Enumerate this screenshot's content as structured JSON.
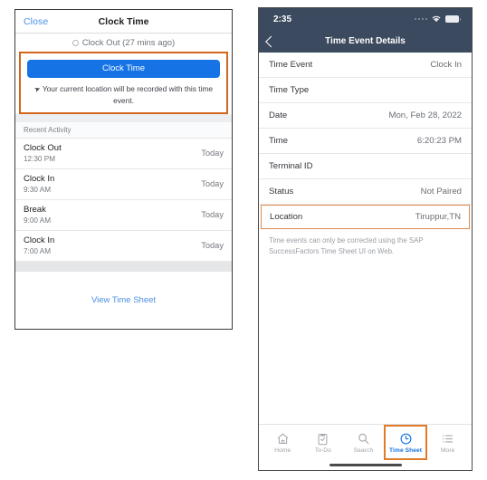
{
  "left_panel": {
    "header": {
      "close_label": "Close",
      "title": "Clock Time"
    },
    "status_option": {
      "label": "Clock Out (27 mins ago)",
      "radio_state": "unselected"
    },
    "primary_button": {
      "label": "Clock Time",
      "color": "#1673e6"
    },
    "location_note": "Your current location will be recorded with this time event.",
    "highlight_color": "#d4661e",
    "recent_activity": {
      "section_title": "Recent Activity",
      "rows": [
        {
          "title": "Clock Out",
          "time": "12:30 PM",
          "day": "Today"
        },
        {
          "title": "Clock In",
          "time": "9:30 AM",
          "day": "Today"
        },
        {
          "title": "Break",
          "time": "9:00 AM",
          "day": "Today"
        },
        {
          "title": "Clock In",
          "time": "7:00 AM",
          "day": "Today"
        }
      ]
    },
    "footer_link": "View Time Sheet"
  },
  "right_panel": {
    "status_bar": {
      "time": "2:35",
      "wifi_icon": "wifi-icon",
      "battery_icon": "battery-icon",
      "signal_icon": "signal-dots-icon"
    },
    "nav": {
      "back_icon": "chevron-left-icon",
      "title": "Time Event Details"
    },
    "details": [
      {
        "label": "Time Event",
        "value": "Clock In",
        "highlighted": false
      },
      {
        "label": "Time Type",
        "value": "",
        "highlighted": false
      },
      {
        "label": "Date",
        "value": "Mon, Feb 28, 2022",
        "highlighted": false
      },
      {
        "label": "Time",
        "value": "6:20:23 PM",
        "highlighted": false
      },
      {
        "label": "Terminal ID",
        "value": "",
        "highlighted": false
      },
      {
        "label": "Status",
        "value": "Not Paired",
        "highlighted": false
      },
      {
        "label": "Location",
        "value": "Tiruppur,TN",
        "highlighted": true
      }
    ],
    "highlight_color": "#e08a4d",
    "footer_note": "Time events can only be corrected using the SAP SuccessFactors Time Sheet UI on Web.",
    "tabs": [
      {
        "label": "Home",
        "icon": "home-icon",
        "active": false
      },
      {
        "label": "To-Do",
        "icon": "clipboard-check-icon",
        "active": false
      },
      {
        "label": "Search",
        "icon": "search-icon",
        "active": false
      },
      {
        "label": "Time Sheet",
        "icon": "clock-icon",
        "active": true
      },
      {
        "label": "More",
        "icon": "list-menu-icon",
        "active": false
      }
    ],
    "tab_highlight_color": "#e07b28",
    "active_tab_color": "#1673e6"
  }
}
